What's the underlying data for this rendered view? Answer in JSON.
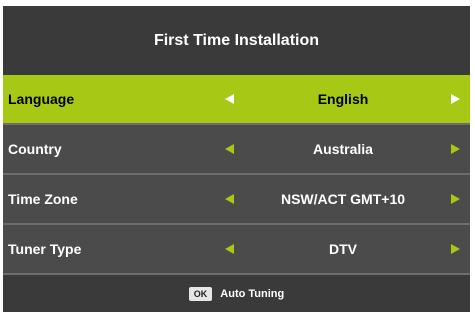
{
  "title": "First Time Installation",
  "rows": [
    {
      "label": "Language",
      "value": "English",
      "selected": true
    },
    {
      "label": "Country",
      "value": "Australia",
      "selected": false
    },
    {
      "label": "Time Zone",
      "value": "NSW/ACT GMT+10",
      "selected": false
    },
    {
      "label": "Tuner Type",
      "value": "DTV",
      "selected": false
    }
  ],
  "footer": {
    "key_label": "OK",
    "action_label": "Auto Tuning"
  },
  "colors": {
    "highlight": "#a7c815",
    "panel": "#4b4b4b",
    "header": "#3a3a3a"
  },
  "icons": {
    "left": "triangle-left-icon",
    "right": "triangle-right-icon"
  }
}
